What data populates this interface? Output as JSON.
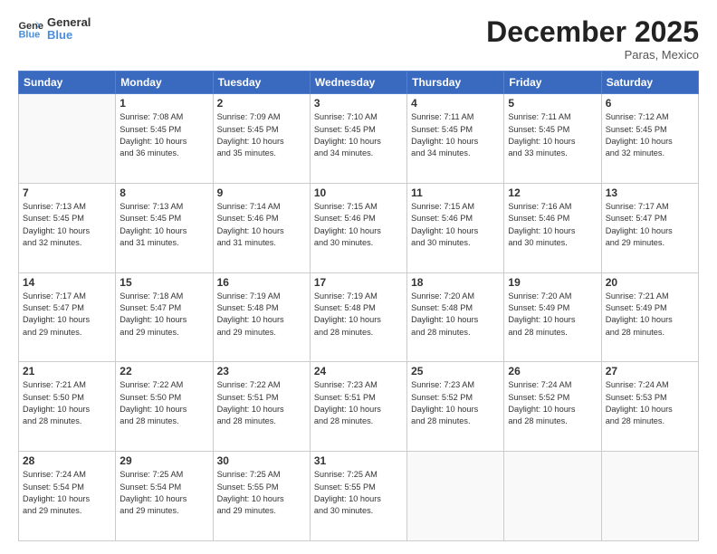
{
  "header": {
    "logo": {
      "line1": "General",
      "line2": "Blue"
    },
    "title": "December 2025",
    "subtitle": "Paras, Mexico"
  },
  "weekdays": [
    "Sunday",
    "Monday",
    "Tuesday",
    "Wednesday",
    "Thursday",
    "Friday",
    "Saturday"
  ],
  "weeks": [
    [
      {
        "day": "",
        "info": ""
      },
      {
        "day": "1",
        "info": "Sunrise: 7:08 AM\nSunset: 5:45 PM\nDaylight: 10 hours\nand 36 minutes."
      },
      {
        "day": "2",
        "info": "Sunrise: 7:09 AM\nSunset: 5:45 PM\nDaylight: 10 hours\nand 35 minutes."
      },
      {
        "day": "3",
        "info": "Sunrise: 7:10 AM\nSunset: 5:45 PM\nDaylight: 10 hours\nand 34 minutes."
      },
      {
        "day": "4",
        "info": "Sunrise: 7:11 AM\nSunset: 5:45 PM\nDaylight: 10 hours\nand 34 minutes."
      },
      {
        "day": "5",
        "info": "Sunrise: 7:11 AM\nSunset: 5:45 PM\nDaylight: 10 hours\nand 33 minutes."
      },
      {
        "day": "6",
        "info": "Sunrise: 7:12 AM\nSunset: 5:45 PM\nDaylight: 10 hours\nand 32 minutes."
      }
    ],
    [
      {
        "day": "7",
        "info": "Sunrise: 7:13 AM\nSunset: 5:45 PM\nDaylight: 10 hours\nand 32 minutes."
      },
      {
        "day": "8",
        "info": "Sunrise: 7:13 AM\nSunset: 5:45 PM\nDaylight: 10 hours\nand 31 minutes."
      },
      {
        "day": "9",
        "info": "Sunrise: 7:14 AM\nSunset: 5:46 PM\nDaylight: 10 hours\nand 31 minutes."
      },
      {
        "day": "10",
        "info": "Sunrise: 7:15 AM\nSunset: 5:46 PM\nDaylight: 10 hours\nand 30 minutes."
      },
      {
        "day": "11",
        "info": "Sunrise: 7:15 AM\nSunset: 5:46 PM\nDaylight: 10 hours\nand 30 minutes."
      },
      {
        "day": "12",
        "info": "Sunrise: 7:16 AM\nSunset: 5:46 PM\nDaylight: 10 hours\nand 30 minutes."
      },
      {
        "day": "13",
        "info": "Sunrise: 7:17 AM\nSunset: 5:47 PM\nDaylight: 10 hours\nand 29 minutes."
      }
    ],
    [
      {
        "day": "14",
        "info": "Sunrise: 7:17 AM\nSunset: 5:47 PM\nDaylight: 10 hours\nand 29 minutes."
      },
      {
        "day": "15",
        "info": "Sunrise: 7:18 AM\nSunset: 5:47 PM\nDaylight: 10 hours\nand 29 minutes."
      },
      {
        "day": "16",
        "info": "Sunrise: 7:19 AM\nSunset: 5:48 PM\nDaylight: 10 hours\nand 29 minutes."
      },
      {
        "day": "17",
        "info": "Sunrise: 7:19 AM\nSunset: 5:48 PM\nDaylight: 10 hours\nand 28 minutes."
      },
      {
        "day": "18",
        "info": "Sunrise: 7:20 AM\nSunset: 5:48 PM\nDaylight: 10 hours\nand 28 minutes."
      },
      {
        "day": "19",
        "info": "Sunrise: 7:20 AM\nSunset: 5:49 PM\nDaylight: 10 hours\nand 28 minutes."
      },
      {
        "day": "20",
        "info": "Sunrise: 7:21 AM\nSunset: 5:49 PM\nDaylight: 10 hours\nand 28 minutes."
      }
    ],
    [
      {
        "day": "21",
        "info": "Sunrise: 7:21 AM\nSunset: 5:50 PM\nDaylight: 10 hours\nand 28 minutes."
      },
      {
        "day": "22",
        "info": "Sunrise: 7:22 AM\nSunset: 5:50 PM\nDaylight: 10 hours\nand 28 minutes."
      },
      {
        "day": "23",
        "info": "Sunrise: 7:22 AM\nSunset: 5:51 PM\nDaylight: 10 hours\nand 28 minutes."
      },
      {
        "day": "24",
        "info": "Sunrise: 7:23 AM\nSunset: 5:51 PM\nDaylight: 10 hours\nand 28 minutes."
      },
      {
        "day": "25",
        "info": "Sunrise: 7:23 AM\nSunset: 5:52 PM\nDaylight: 10 hours\nand 28 minutes."
      },
      {
        "day": "26",
        "info": "Sunrise: 7:24 AM\nSunset: 5:52 PM\nDaylight: 10 hours\nand 28 minutes."
      },
      {
        "day": "27",
        "info": "Sunrise: 7:24 AM\nSunset: 5:53 PM\nDaylight: 10 hours\nand 28 minutes."
      }
    ],
    [
      {
        "day": "28",
        "info": "Sunrise: 7:24 AM\nSunset: 5:54 PM\nDaylight: 10 hours\nand 29 minutes."
      },
      {
        "day": "29",
        "info": "Sunrise: 7:25 AM\nSunset: 5:54 PM\nDaylight: 10 hours\nand 29 minutes."
      },
      {
        "day": "30",
        "info": "Sunrise: 7:25 AM\nSunset: 5:55 PM\nDaylight: 10 hours\nand 29 minutes."
      },
      {
        "day": "31",
        "info": "Sunrise: 7:25 AM\nSunset: 5:55 PM\nDaylight: 10 hours\nand 30 minutes."
      },
      {
        "day": "",
        "info": ""
      },
      {
        "day": "",
        "info": ""
      },
      {
        "day": "",
        "info": ""
      }
    ]
  ]
}
